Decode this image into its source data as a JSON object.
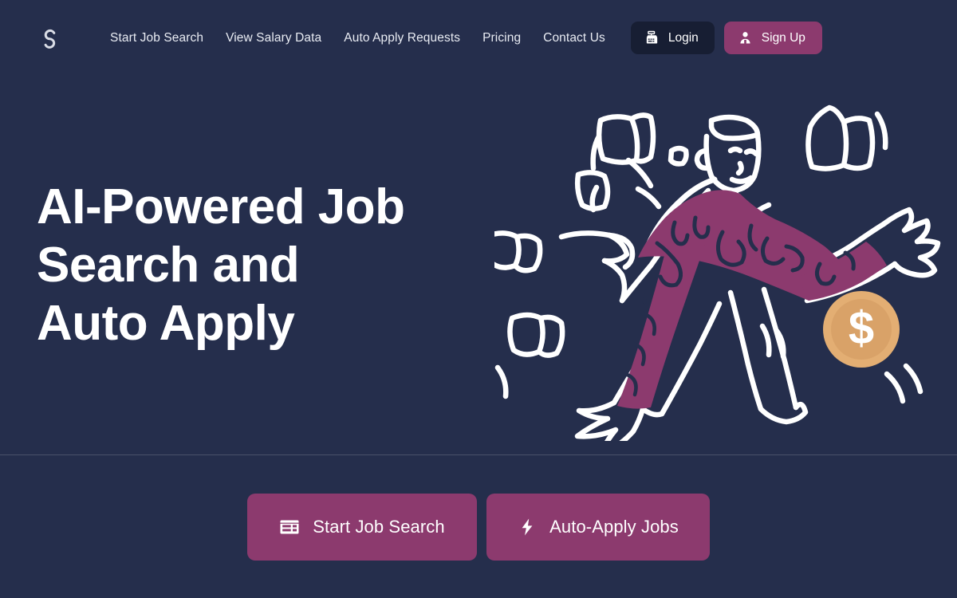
{
  "brand": {
    "logo_icon": "spiral-s-logo-icon",
    "logo_color": "#DADDE6"
  },
  "theme": {
    "background": "#252E4C",
    "accent_magenta": "#8C3A6E",
    "login_dark": "#171E33",
    "text_primary": "#FFFFFF",
    "nav_text": "#E9ECF3",
    "coin_gold": "#E3AE73",
    "divider": "rgba(255,255,255,0.17)"
  },
  "header": {
    "nav": [
      {
        "label": "Start Job Search",
        "name": "nav-start-job-search"
      },
      {
        "label": "View Salary Data",
        "name": "nav-view-salary-data"
      },
      {
        "label": "Auto Apply Requests",
        "name": "nav-auto-apply-requests"
      },
      {
        "label": "Pricing",
        "name": "nav-pricing"
      },
      {
        "label": "Contact Us",
        "name": "nav-contact-us"
      }
    ],
    "login": {
      "label": "Login",
      "icon": "cash-register-icon"
    },
    "signup": {
      "label": "Sign Up",
      "icon": "user-person-icon"
    }
  },
  "hero": {
    "headline": "AI-Powered Job Search and Auto Apply",
    "illustration": {
      "name": "person-juggling-papers-with-dollar-coin-illustration",
      "coin_symbol": "$",
      "shirt_color": "#8C3A6E",
      "line_color": "#FFFFFF"
    }
  },
  "cta": {
    "buttons": [
      {
        "label": "Start Job Search",
        "icon": "job-card-listing-icon",
        "name": "cta-start-job-search"
      },
      {
        "label": "Auto-Apply Jobs",
        "icon": "lightning-bolt-icon",
        "name": "cta-auto-apply-jobs"
      }
    ]
  }
}
